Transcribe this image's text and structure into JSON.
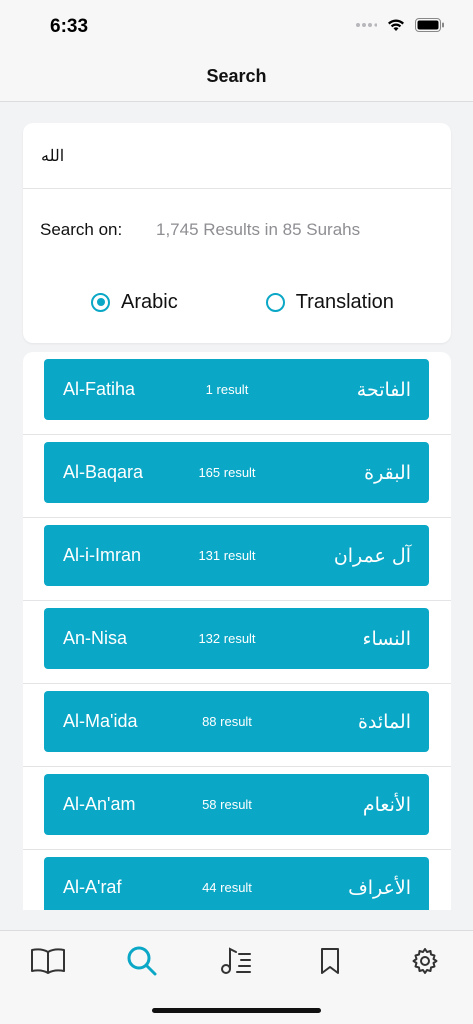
{
  "status": {
    "time": "6:33"
  },
  "nav": {
    "title": "Search"
  },
  "search": {
    "query": "الله",
    "search_on_label": "Search on:",
    "results_summary": "1,745 Results in 85 Surahs",
    "options": [
      {
        "label": "Arabic",
        "selected": true
      },
      {
        "label": "Translation",
        "selected": false
      }
    ]
  },
  "results": [
    {
      "name": "Al-Fatiha",
      "count": "1 result",
      "arabic": "الفاتحة"
    },
    {
      "name": "Al-Baqara",
      "count": "165 result",
      "arabic": "البقرة"
    },
    {
      "name": "Al-i-Imran",
      "count": "131 result",
      "arabic": "آل عمران"
    },
    {
      "name": "An-Nisa",
      "count": "132 result",
      "arabic": "النساء"
    },
    {
      "name": "Al-Ma'ida",
      "count": "88 result",
      "arabic": "المائدة"
    },
    {
      "name": "Al-An'am",
      "count": "58 result",
      "arabic": "الأنعام"
    },
    {
      "name": "Al-A'raf",
      "count": "44 result",
      "arabic": "الأعراف"
    }
  ],
  "tabs": [
    {
      "icon": "book-icon",
      "active": false
    },
    {
      "icon": "search-icon",
      "active": true
    },
    {
      "icon": "audio-playlist-icon",
      "active": false
    },
    {
      "icon": "bookmark-icon",
      "active": false
    },
    {
      "icon": "gear-icon",
      "active": false
    }
  ],
  "colors": {
    "accent": "#0aa7c6",
    "inactive_icon": "#333333"
  }
}
